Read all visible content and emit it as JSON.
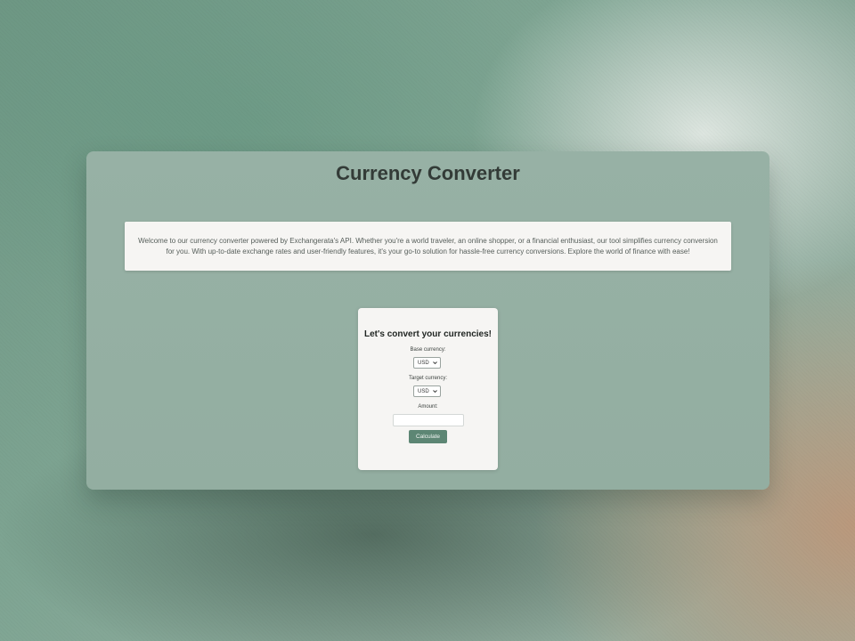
{
  "page": {
    "title": "Currency Converter",
    "intro_text": "Welcome to our currency converter powered by Exchangerata's API. Whether you're a world traveler, an online shopper, or a financial enthusiast, our tool simplifies currency conversion for you. With up-to-date exchange rates and user-friendly features, it's your go-to solution for hassle-free currency conversions. Explore the world of finance with ease!"
  },
  "converter": {
    "heading": "Let's convert your currencies!",
    "base_label": "Base currency:",
    "base_value": "USD",
    "target_label": "Target currency:",
    "target_value": "USD",
    "amount_label": "Amount:",
    "amount_value": "",
    "calculate_label": "Calculate"
  },
  "colors": {
    "panel": "#95afa3",
    "button": "#5d8674",
    "card": "#f6f5f3"
  }
}
